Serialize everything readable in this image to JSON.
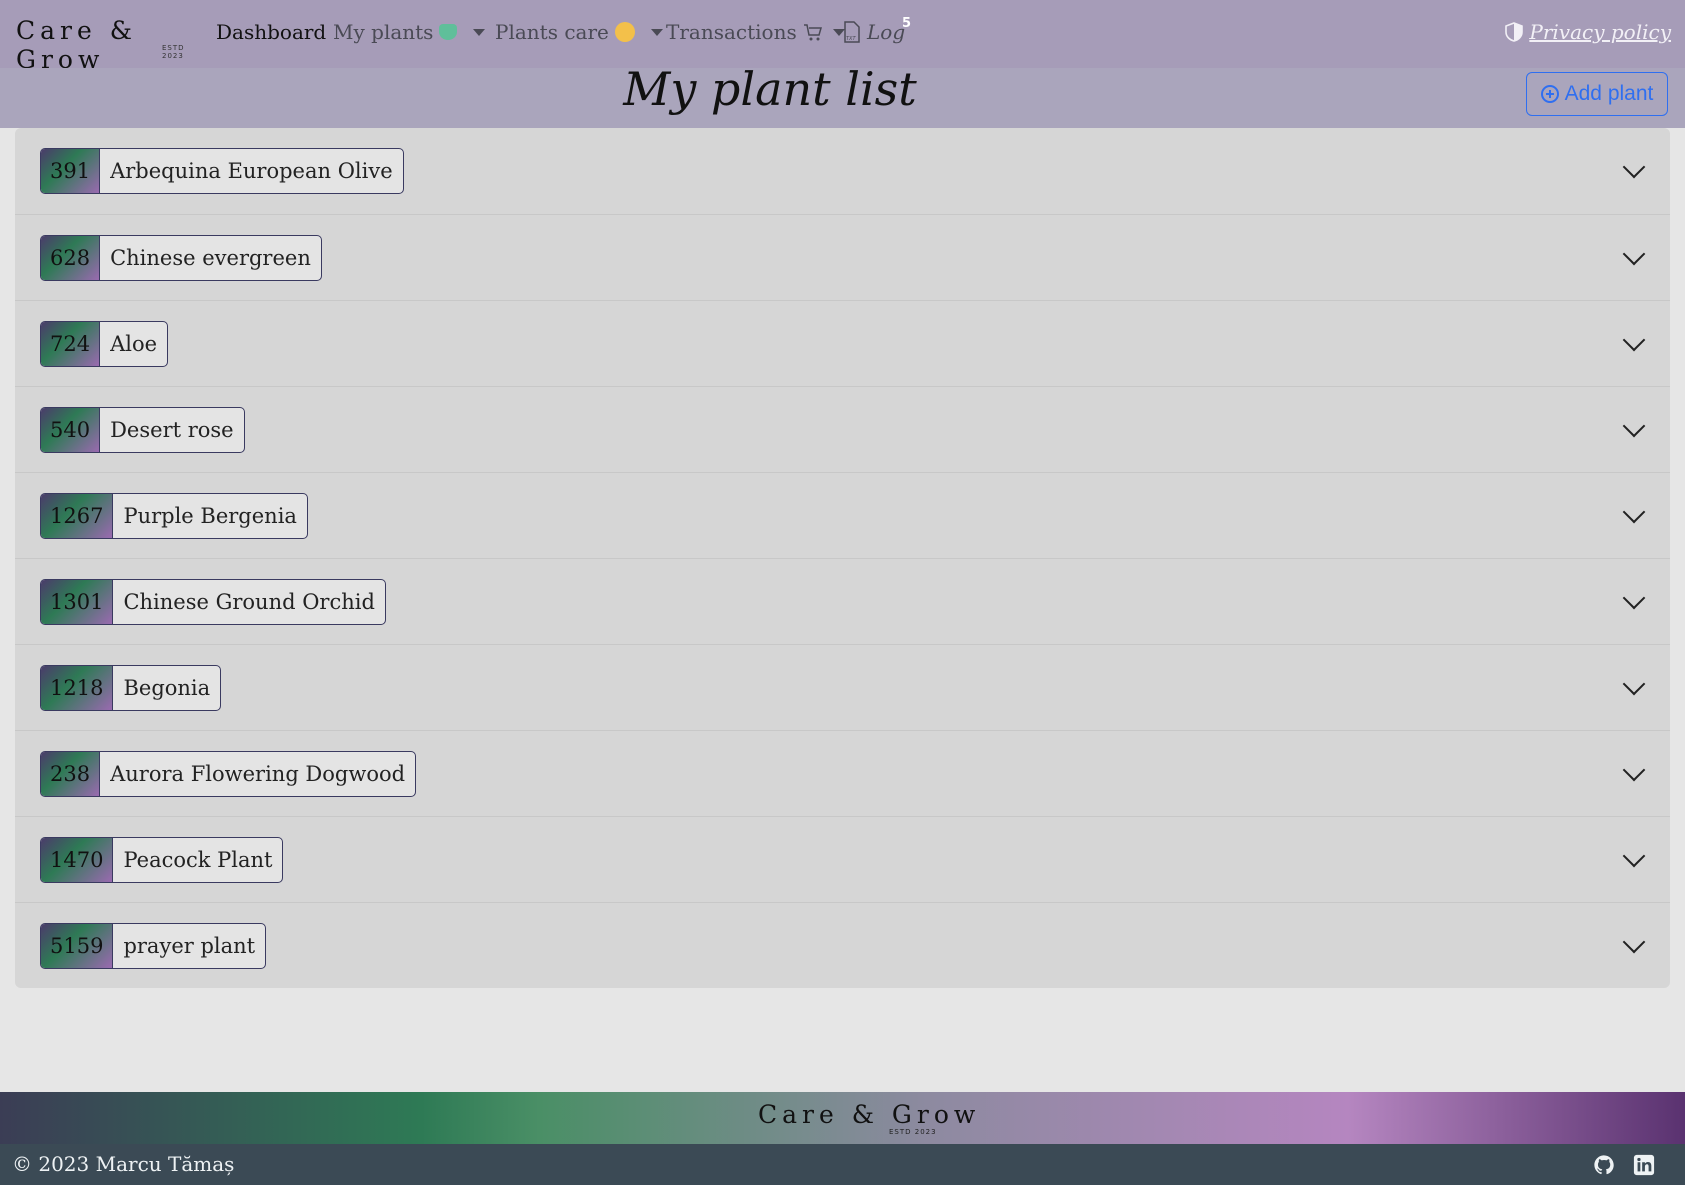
{
  "navbar": {
    "brand": "Care & Grow",
    "brand_estd": "ESTD 2023",
    "dashboard": "Dashboard",
    "my_plants": "My plants",
    "plants_care": "Plants care",
    "transactions": "Transactions",
    "log": "Log",
    "log_badge": "5",
    "privacy": "Privacy policy"
  },
  "page": {
    "title": "My plant list",
    "add_button": "Add plant"
  },
  "plants": [
    {
      "id": "391",
      "name": "Arbequina European Olive"
    },
    {
      "id": "628",
      "name": "Chinese evergreen"
    },
    {
      "id": "724",
      "name": "Aloe"
    },
    {
      "id": "540",
      "name": "Desert rose"
    },
    {
      "id": "1267",
      "name": "Purple Bergenia"
    },
    {
      "id": "1301",
      "name": "Chinese Ground Orchid"
    },
    {
      "id": "1218",
      "name": "Begonia"
    },
    {
      "id": "238",
      "name": "Aurora Flowering Dogwood"
    },
    {
      "id": "1470",
      "name": "Peacock Plant"
    },
    {
      "id": "5159",
      "name": "prayer plant"
    }
  ],
  "footer": {
    "brand": "Care & Grow",
    "brand_estd": "ESTD 2023",
    "copyright": "© 2023 Marcu Tămaș"
  }
}
